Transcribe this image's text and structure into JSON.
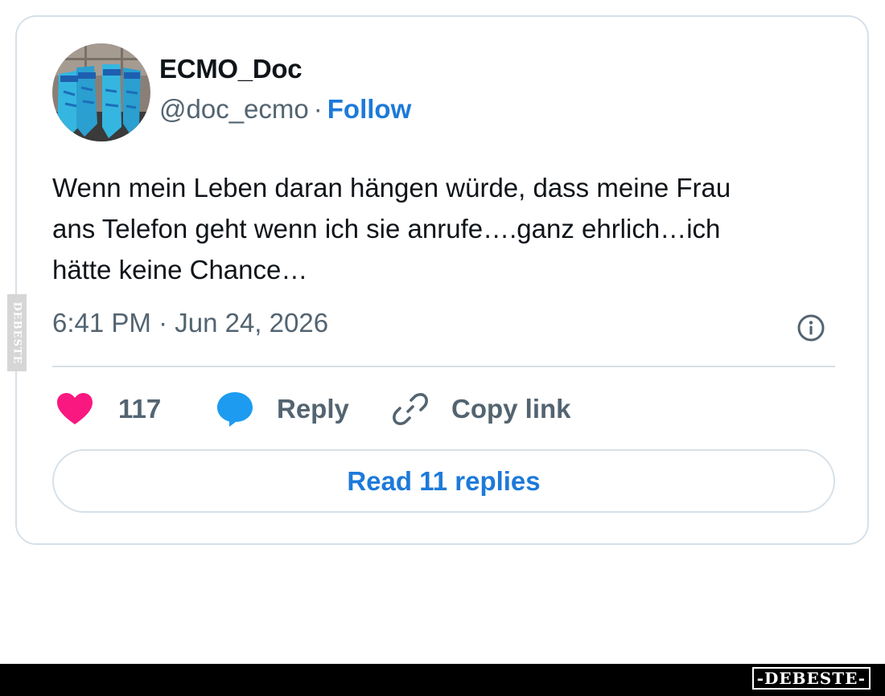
{
  "tweet": {
    "author_name": "ECMO_Doc",
    "handle": "@doc_ecmo",
    "separator": "·",
    "follow_label": "Follow",
    "text": "Wenn mein Leben daran hängen würde, dass meine Frau\nans Telefon geht wenn ich sie anrufe….ganz ehrlich…ich\nhätte keine Chance…",
    "timestamp": "6:41 PM · Jun 24, 2026"
  },
  "actions": {
    "like_count": "117",
    "reply_label": "Reply",
    "copy_link_label": "Copy link"
  },
  "read_replies_label": "Read 11 replies",
  "watermark": {
    "side_text": "DEBESTE",
    "bottom_text": "-DEBESTE-"
  },
  "colors": {
    "follow_blue": "#1d7ad9",
    "heart_pink": "#f91880",
    "reply_bubble_blue": "#1d9bf0",
    "secondary_gray": "#536471",
    "border": "#d6e0e8"
  },
  "icons": [
    "heart-icon",
    "reply-bubble-icon",
    "link-icon",
    "info-icon"
  ]
}
